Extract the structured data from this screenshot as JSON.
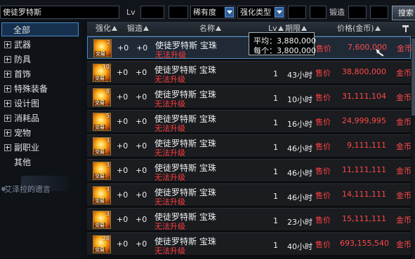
{
  "search": {
    "name_value": "使徒罗特斯",
    "level_label": "Lv",
    "level_min": "",
    "level_max": ""
  },
  "filters": {
    "rarity": "稀有度",
    "enhance_type": "强化类型",
    "enhance_min": "",
    "enhance_max": "",
    "forge_label": "锻造",
    "forge_min": "",
    "forge_max": "",
    "search_button": "搜索"
  },
  "categories": [
    {
      "label": "全部",
      "selected": true
    },
    {
      "label": "武器"
    },
    {
      "label": "防具"
    },
    {
      "label": "首饰"
    },
    {
      "label": "特殊装备"
    },
    {
      "label": "设计图"
    },
    {
      "label": "消耗品"
    },
    {
      "label": "宠物"
    },
    {
      "label": "副职业"
    },
    {
      "label": "其他"
    }
  ],
  "side_ghost_text": "艾泽拉的遗言",
  "columns": {
    "enhance": "强化",
    "forge": "锻造",
    "name": "名称",
    "lv": "Lv",
    "period": "期限",
    "price": "价格(金币)",
    "sort_icon": "hammer-icon"
  },
  "rows": [
    {
      "icon_level": "2",
      "icon_tag": "交易",
      "enhance": "+0",
      "forge": "+0",
      "name": "使徒罗特斯 宝珠",
      "note": "无法升级",
      "lv": "",
      "period": "",
      "status": "售价",
      "price": "7,600,000",
      "currency": "金币",
      "selected": true
    },
    {
      "icon_level": "10",
      "icon_tag": "交易",
      "enhance": "+0",
      "forge": "+0",
      "name": "使徒罗特斯 宝珠",
      "note": "无法升级",
      "lv": "1",
      "period": "43小时",
      "status": "售价",
      "price": "38,800,000",
      "currency": "金币"
    },
    {
      "icon_level": "8",
      "icon_tag": "交易",
      "enhance": "+0",
      "forge": "+0",
      "name": "使徒罗特斯 宝珠",
      "note": "无法升级",
      "lv": "1",
      "period": "10小时",
      "status": "售价",
      "price": "31,111,104",
      "currency": "金币"
    },
    {
      "icon_level": "5",
      "icon_tag": "交易",
      "enhance": "+0",
      "forge": "+0",
      "name": "使徒罗特斯 宝珠",
      "note": "无法升级",
      "lv": "1",
      "period": "16小时",
      "status": "售价",
      "price": "24,999,995",
      "currency": "金币"
    },
    {
      "icon_level": "3",
      "icon_tag": "交易",
      "enhance": "+0",
      "forge": "+0",
      "name": "使徒罗特斯 宝珠",
      "note": "无法升级",
      "lv": "1",
      "period": "46小时",
      "status": "售价",
      "price": "9,111,111",
      "currency": "金币"
    },
    {
      "icon_level": "3",
      "icon_tag": "交易",
      "enhance": "+0",
      "forge": "+0",
      "name": "使徒罗特斯 宝珠",
      "note": "无法升级",
      "lv": "1",
      "period": "46小时",
      "status": "售价",
      "price": "11,111,111",
      "currency": "金币"
    },
    {
      "icon_level": "3",
      "icon_tag": "交易",
      "enhance": "+0",
      "forge": "+0",
      "name": "使徒罗特斯 宝珠",
      "note": "无法升级",
      "lv": "1",
      "period": "46小时",
      "status": "售价",
      "price": "14,111,111",
      "currency": "金币"
    },
    {
      "icon_level": "3",
      "icon_tag": "交易",
      "enhance": "+0",
      "forge": "+0",
      "name": "使徒罗特斯 宝珠",
      "note": "无法升级",
      "lv": "1",
      "period": "23小时",
      "status": "售价",
      "price": "15,111,111",
      "currency": "金币"
    },
    {
      "icon_level": "28",
      "icon_tag": "交易",
      "enhance": "+0",
      "forge": "+0",
      "name": "使徒罗特斯 宝珠",
      "note": "无法升级",
      "lv": "1",
      "period": "40小时",
      "status": "售价",
      "price": "693,155,540",
      "currency": "金币"
    }
  ],
  "tooltip": {
    "avg": "平均：3,880,000",
    "each": "每个：3,800,000"
  },
  "colors": {
    "price_red": "#ff4848",
    "note_red": "#ff3b3b",
    "select_blue": "#4e8cc9"
  }
}
